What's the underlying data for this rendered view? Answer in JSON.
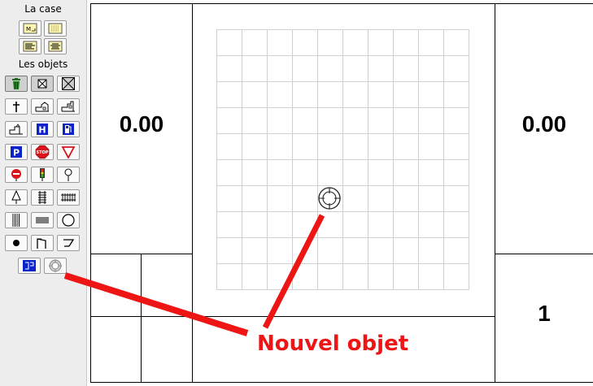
{
  "sidebar": {
    "case_section_title": "La case",
    "objects_section_title": "Les objets",
    "case_tools": [
      {
        "icon": "cell-m-icon"
      },
      {
        "icon": "cell-grid-icon"
      },
      {
        "icon": "text-left-icon"
      },
      {
        "icon": "text-center-icon"
      }
    ],
    "object_tools": [
      {
        "icon": "trash-icon"
      },
      {
        "icon": "box-x-small-icon"
      },
      {
        "icon": "box-x-large-icon"
      },
      {
        "icon": "cross-icon"
      },
      {
        "icon": "house-icon"
      },
      {
        "icon": "factory-icon"
      },
      {
        "icon": "building-icon"
      },
      {
        "icon": "hospital-icon"
      },
      {
        "icon": "fuel-pump-icon"
      },
      {
        "icon": "parking-icon"
      },
      {
        "icon": "stop-sign-icon"
      },
      {
        "icon": "yield-sign-icon"
      },
      {
        "icon": "no-entry-icon"
      },
      {
        "icon": "traffic-light-icon"
      },
      {
        "icon": "pin-icon"
      },
      {
        "icon": "tree-icon"
      },
      {
        "icon": "rail-track-vertical-icon"
      },
      {
        "icon": "rail-track-horizontal-icon"
      },
      {
        "icon": "lines-vertical-icon"
      },
      {
        "icon": "lines-horizontal-icon"
      },
      {
        "icon": "circle-icon"
      },
      {
        "icon": "dot-icon"
      },
      {
        "icon": "barrier-left-icon"
      },
      {
        "icon": "barrier-right-icon"
      },
      {
        "icon": "blue-box-icon"
      },
      {
        "icon": "target-icon"
      }
    ]
  },
  "board": {
    "top_left_value": "0.00",
    "top_right_value": "0.00",
    "bottom_right_value": "1",
    "grid_rows": 10,
    "grid_cols": 10
  },
  "annotation": {
    "label": "Nouvel objet",
    "color": "#ee1515"
  },
  "colors": {
    "accent_blue": "#0b23c9",
    "sign_red": "#d9141a",
    "grid_line": "#cfcfcf"
  }
}
